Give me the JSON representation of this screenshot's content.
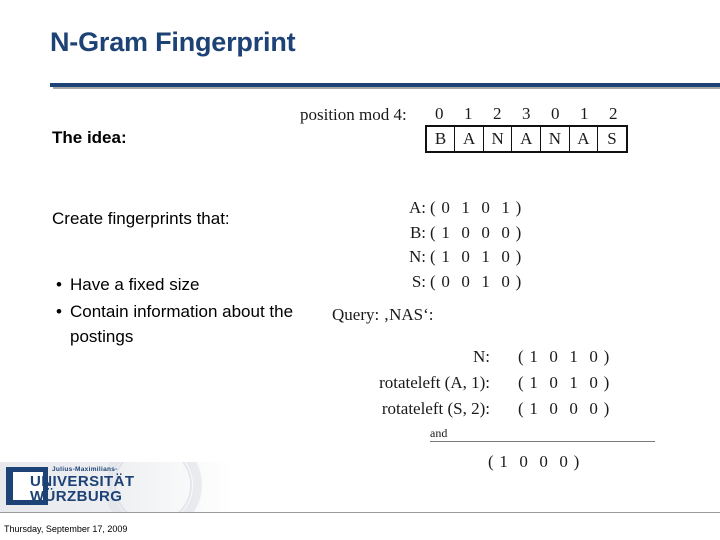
{
  "slide": {
    "title": "N-Gram Fingerprint",
    "lead": "The idea:",
    "subhead": "Create fingerprints that:",
    "bullet_marker": "•",
    "bullets": [
      "Have a fixed size",
      "Contain information about the postings"
    ]
  },
  "figure": {
    "position_label": "position mod 4:",
    "position_numbers": [
      "0",
      "1",
      "2",
      "3",
      "0",
      "1",
      "2"
    ],
    "letters": [
      "B",
      "A",
      "N",
      "A",
      "N",
      "A",
      "S"
    ],
    "vectors": [
      {
        "key": "A:",
        "open": "(",
        "bits": [
          "0",
          "1",
          "0",
          "1"
        ],
        "close": ")"
      },
      {
        "key": "B:",
        "open": "(",
        "bits": [
          "1",
          "0",
          "0",
          "0"
        ],
        "close": ")"
      },
      {
        "key": "N:",
        "open": "(",
        "bits": [
          "1",
          "0",
          "1",
          "0"
        ],
        "close": ")"
      },
      {
        "key": "S:",
        "open": "(",
        "bits": [
          "0",
          "0",
          "1",
          "0"
        ],
        "close": ")"
      }
    ],
    "query_label": "Query: ‚NAS‘:",
    "query_rows": [
      {
        "name": "N:",
        "open": "(",
        "bits": [
          "1",
          "0",
          "1",
          "0"
        ],
        "close": ")"
      },
      {
        "name": "rotateleft (A, 1):",
        "open": "(",
        "bits": [
          "1",
          "0",
          "1",
          "0"
        ],
        "close": ")"
      },
      {
        "name": "rotateleft (S, 2):",
        "open": "(",
        "bits": [
          "1",
          "0",
          "0",
          "0"
        ],
        "close": ")"
      }
    ],
    "and_word": "and",
    "result": {
      "open": "(",
      "bits": [
        "1",
        "0",
        "0",
        "0"
      ],
      "close": ")"
    }
  },
  "footer": {
    "logo_sub": "Julius-Maximilians-",
    "logo_line1": "UNIVERSITÄT",
    "logo_line2": "WÜRZBURG",
    "date": "Thursday, September 17, 2009"
  },
  "colors": {
    "brand_blue": "#1d4275",
    "rule_gray": "#9a9a9a"
  }
}
